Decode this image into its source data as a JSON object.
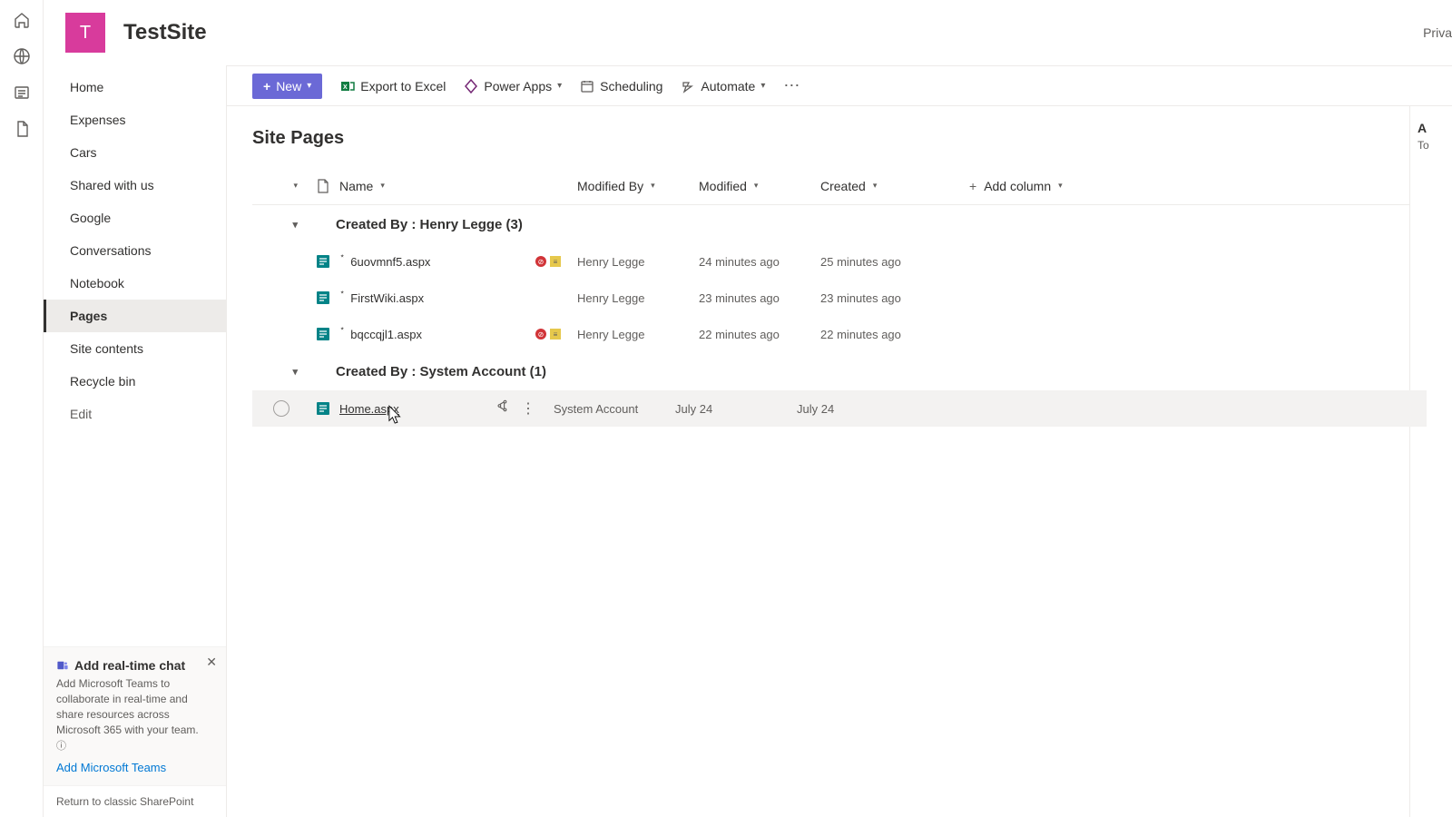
{
  "site": {
    "logoLetter": "T",
    "title": "TestSite",
    "privacy": "Priva"
  },
  "rail": {
    "icons": [
      "home-icon",
      "globe-icon",
      "grid-icon",
      "file-icon"
    ]
  },
  "sidebar": {
    "items": [
      {
        "label": "Home"
      },
      {
        "label": "Expenses"
      },
      {
        "label": "Cars"
      },
      {
        "label": "Shared with us"
      },
      {
        "label": "Google"
      },
      {
        "label": "Conversations"
      },
      {
        "label": "Notebook"
      },
      {
        "label": "Pages",
        "active": true
      },
      {
        "label": "Site contents"
      },
      {
        "label": "Recycle bin"
      },
      {
        "label": "Edit",
        "muted": true
      }
    ],
    "teams": {
      "title": "Add real-time chat",
      "desc": "Add Microsoft Teams to collaborate in real-time and share resources across Microsoft 365 with your team.",
      "link": "Add Microsoft Teams"
    },
    "classic": "Return to classic SharePoint"
  },
  "toolbar": {
    "new": "New",
    "exportExcel": "Export to Excel",
    "powerApps": "Power Apps",
    "scheduling": "Scheduling",
    "automate": "Automate"
  },
  "list": {
    "title": "Site Pages",
    "columns": {
      "name": "Name",
      "modifiedBy": "Modified By",
      "modified": "Modified",
      "created": "Created",
      "addColumn": "Add column"
    },
    "groups": [
      {
        "label": "Created By : Henry Legge (3)",
        "items": [
          {
            "name": "6uovmnf5.aspx",
            "status": true,
            "modifiedBy": "Henry Legge",
            "modified": "24 minutes ago",
            "created": "25 minutes ago"
          },
          {
            "name": "FirstWiki.aspx",
            "status": false,
            "modifiedBy": "Henry Legge",
            "modified": "23 minutes ago",
            "created": "23 minutes ago"
          },
          {
            "name": "bqccqjl1.aspx",
            "status": true,
            "modifiedBy": "Henry Legge",
            "modified": "22 minutes ago",
            "created": "22 minutes ago"
          }
        ]
      },
      {
        "label": "Created By : System Account (1)",
        "items": [
          {
            "name": "Home.aspx",
            "status": false,
            "modifiedBy": "System Account",
            "modified": "July 24",
            "created": "July 24",
            "hovered": true
          }
        ]
      }
    ]
  },
  "detail": {
    "label": "A",
    "sub": "To"
  }
}
